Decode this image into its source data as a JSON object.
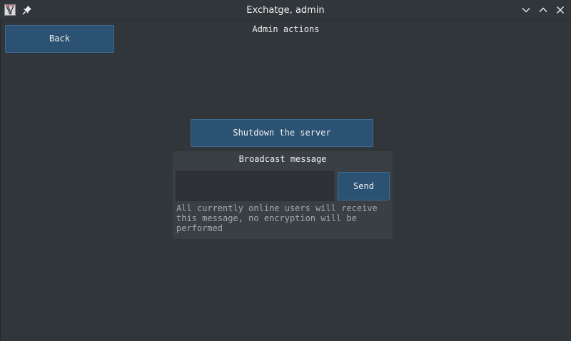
{
  "window": {
    "title": "Exchatge, admin",
    "icons": {
      "app": "app-icon",
      "pin": "pin-icon",
      "minimize": "chevron-down-icon",
      "maximize": "chevron-up-icon",
      "close": "close-icon"
    }
  },
  "page": {
    "back_label": "Back",
    "heading": "Admin actions",
    "shutdown_label": "Shutdown the server"
  },
  "broadcast": {
    "title": "Broadcast message",
    "input_value": "",
    "send_label": "Send",
    "note": "All currently online users will receive\nthis message, no encryption will be\nperformed"
  },
  "colors": {
    "background": "#31363b",
    "button": "#2c5273",
    "panel": "#3a3f44",
    "muted_text": "#a1a9b1",
    "text": "#eff0f1"
  }
}
